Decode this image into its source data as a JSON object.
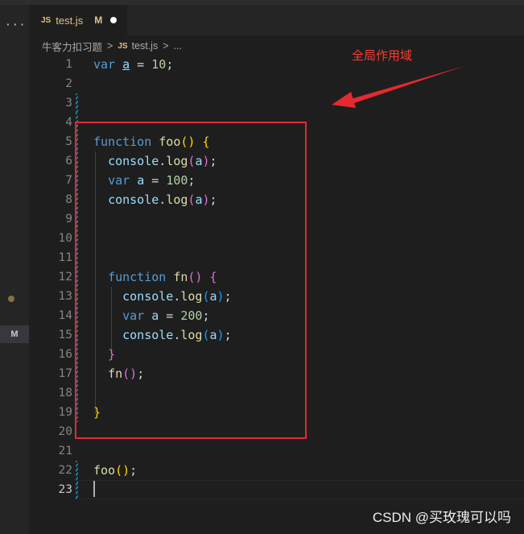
{
  "tab": {
    "js_badge": "JS",
    "title": "test.js",
    "status": "M"
  },
  "breadcrumb": {
    "folder": "牛客力扣习题",
    "sep": ">",
    "js_badge": "JS",
    "file": "test.js",
    "more": "..."
  },
  "activity": {
    "more": "···",
    "scm_badge": "M"
  },
  "editor": {
    "line_numbers": [
      "1",
      "2",
      "3",
      "4",
      "5",
      "6",
      "7",
      "8",
      "9",
      "10",
      "11",
      "12",
      "13",
      "14",
      "15",
      "16",
      "17",
      "18",
      "19",
      "20",
      "21",
      "22",
      "23"
    ]
  },
  "annotation": {
    "label": "全局作用域",
    "color": "#ff3b30",
    "box_color": "#e5292f"
  },
  "watermark": "CSDN @买玫瑰可以吗"
}
